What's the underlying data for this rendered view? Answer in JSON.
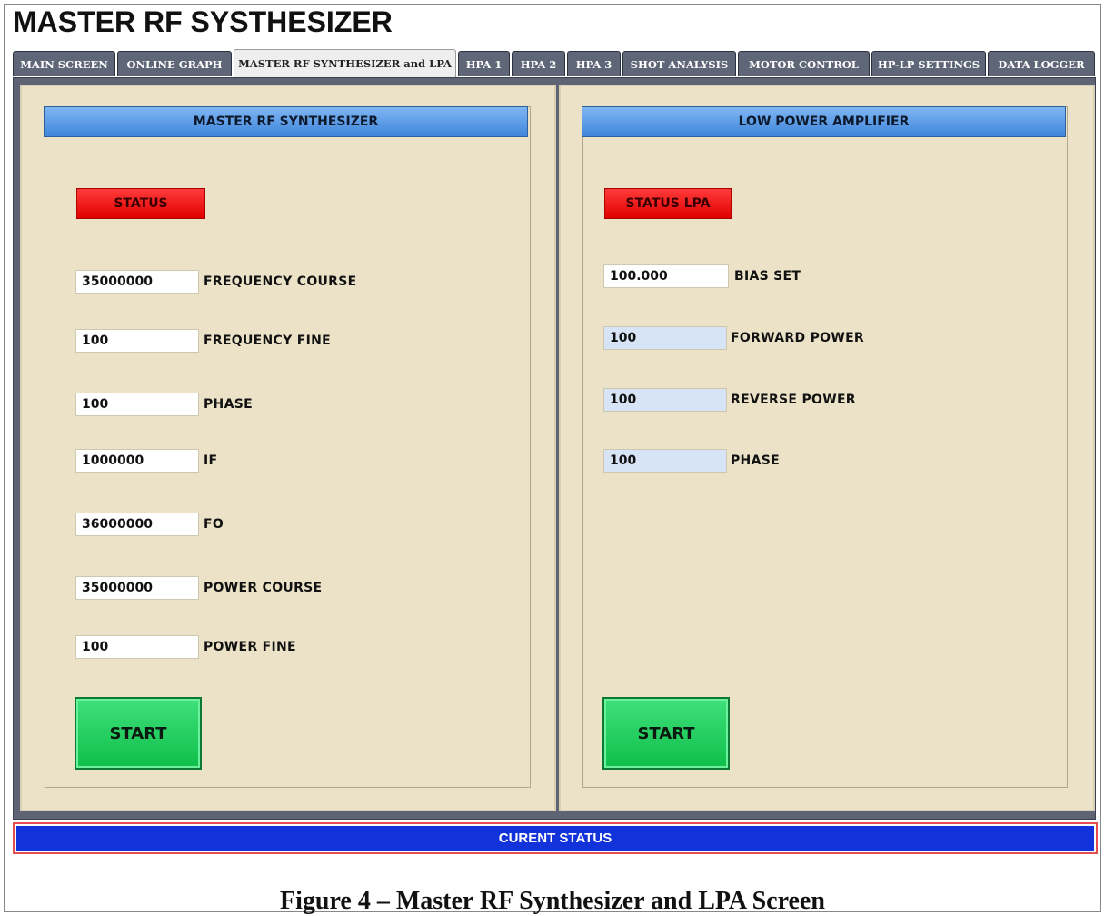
{
  "app": {
    "title": "MASTER RF SYSTHESIZER"
  },
  "tabs": [
    {
      "label": "MAIN SCREEN"
    },
    {
      "label": "ONLINE GRAPH"
    },
    {
      "label": "MASTER RF SYNTHESIZER and LPA"
    },
    {
      "label": "HPA 1"
    },
    {
      "label": "HPA 2"
    },
    {
      "label": "HPA 3"
    },
    {
      "label": "SHOT ANALYSIS"
    },
    {
      "label": "MOTOR CONTROL"
    },
    {
      "label": "HP-LP SETTINGS"
    },
    {
      "label": "DATA LOGGER"
    }
  ],
  "active_tab": "MASTER RF SYNTHESIZER and LPA",
  "synth": {
    "header": "MASTER RF SYNTHESIZER",
    "status_label": "STATUS",
    "fields": [
      {
        "value": "35000000",
        "label": "FREQUENCY COURSE"
      },
      {
        "value": "100",
        "label": "FREQUENCY FINE"
      },
      {
        "value": "100",
        "label": "PHASE"
      },
      {
        "value": "1000000",
        "label": "IF"
      },
      {
        "value": "36000000",
        "label": "FO"
      },
      {
        "value": "35000000",
        "label": "POWER COURSE"
      },
      {
        "value": "100",
        "label": "POWER FINE"
      }
    ],
    "start_label": "START"
  },
  "lpa": {
    "header": "LOW POWER AMPLIFIER",
    "status_label": "STATUS LPA",
    "fields": [
      {
        "value": "100.000",
        "label": "BIAS SET"
      },
      {
        "value": "100",
        "label": "FORWARD POWER"
      },
      {
        "value": "100",
        "label": "REVERSE POWER"
      },
      {
        "value": "100",
        "label": "PHASE"
      }
    ],
    "start_label": "START"
  },
  "status_bar": {
    "text": "CURENT STATUS"
  },
  "caption": "Figure 4 – Master RF Synthesizer and LPA Screen",
  "colors": {
    "panel_bg": "#ebe2c7",
    "header_blue": "#3f86dc",
    "status_red": "#e00000",
    "start_green": "#0fbf4a",
    "status_bar_blue": "#1233d9"
  }
}
